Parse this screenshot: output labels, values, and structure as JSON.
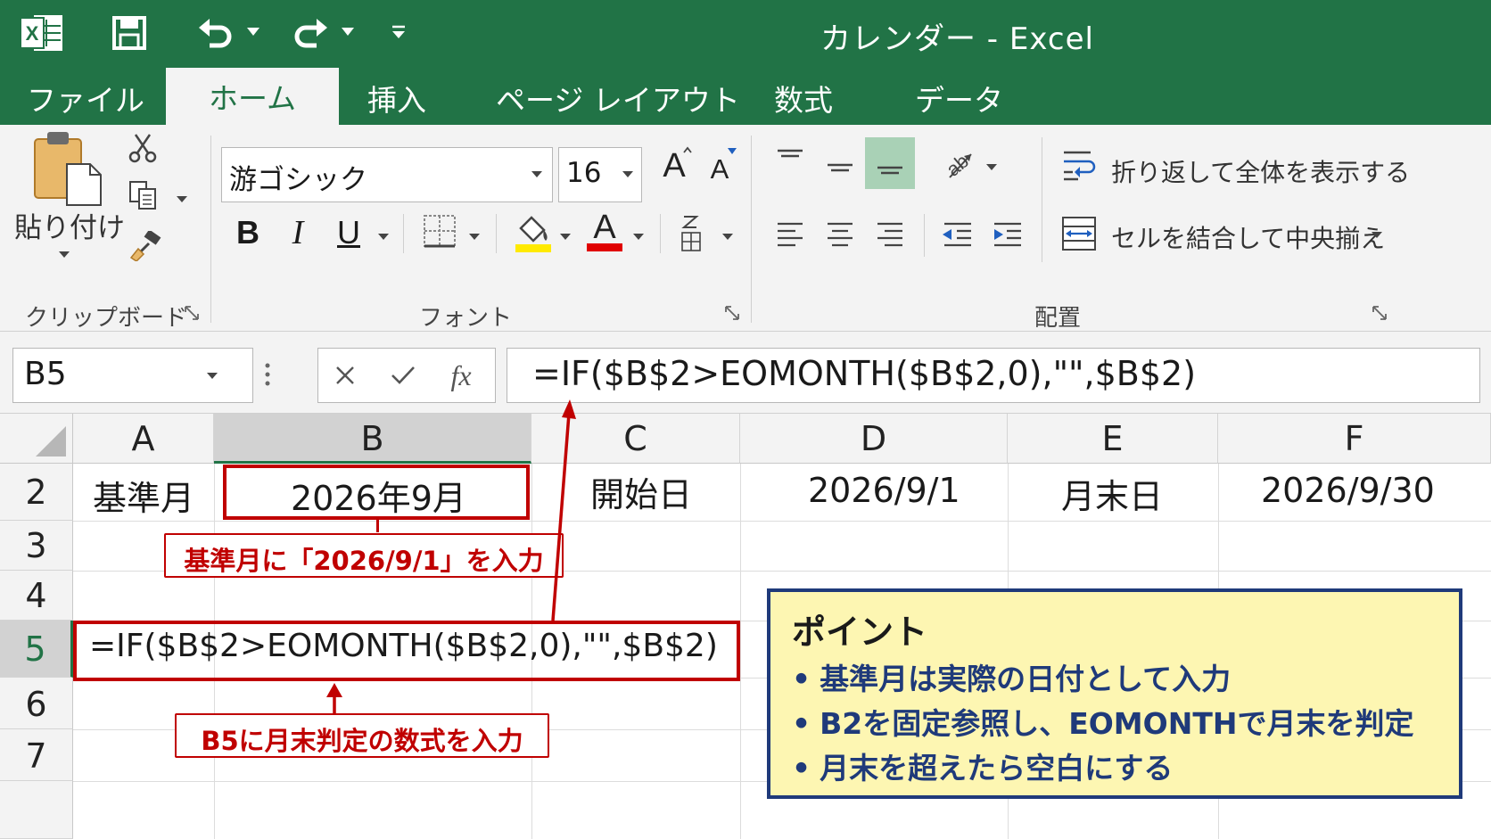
{
  "window": {
    "title": "カレンダー - Excel"
  },
  "ribbon_tabs": [
    "ファイル",
    "ホーム",
    "挿入",
    "ページ レイアウト",
    "数式",
    "データ"
  ],
  "clipboard_group": {
    "paste_label": "貼り付け",
    "group_label": "クリップボード"
  },
  "font_group": {
    "font_name": "游ゴシック",
    "font_size": "16",
    "group_label": "フォント",
    "bold": "B",
    "italic": "I",
    "underline": "U",
    "font_color_letter": "A",
    "grow_font": "A",
    "shrink_font": "A",
    "highlight_color": "#ffea00",
    "font_color": "#e00000"
  },
  "alignment_group": {
    "wrap_text": "折り返して全体を表示する",
    "merge_center": "セルを結合して中央揃え",
    "group_label": "配置"
  },
  "formula_bar": {
    "name_box": "B5",
    "fx": "fx",
    "formula": "=IF($B$2>EOMONTH($B$2,0),\"\",$B$2)"
  },
  "sheet": {
    "columns": [
      "A",
      "B",
      "C",
      "D",
      "E",
      "F"
    ],
    "rows": [
      "2",
      "3",
      "4",
      "5",
      "6",
      "7"
    ],
    "selected_cell": "B5",
    "cells": {
      "A2": "基準月",
      "B2": "2026年9月",
      "C2": "開始日",
      "D2": "2026/9/1",
      "E2": "月末日",
      "F2": "2026/9/30",
      "A5": "=IF($B$2>EOMONTH($B$2,0),\"\",$B$2)"
    }
  },
  "annotations": {
    "callout_b2": "基準月に「2026/9/1」を入力",
    "callout_b5": "B5に月末判定の数式を入力",
    "point": {
      "title": "ポイント",
      "items": [
        "基準月は実際の日付として入力",
        "B2を固定参照し、EOMONTHで月末を判定",
        "月末を超えたら空白にする"
      ]
    },
    "accent_red": "#c00000",
    "accent_navy": "#1f3a7a",
    "note_bg": "#fdf6b2",
    "excel_green": "#217346"
  }
}
